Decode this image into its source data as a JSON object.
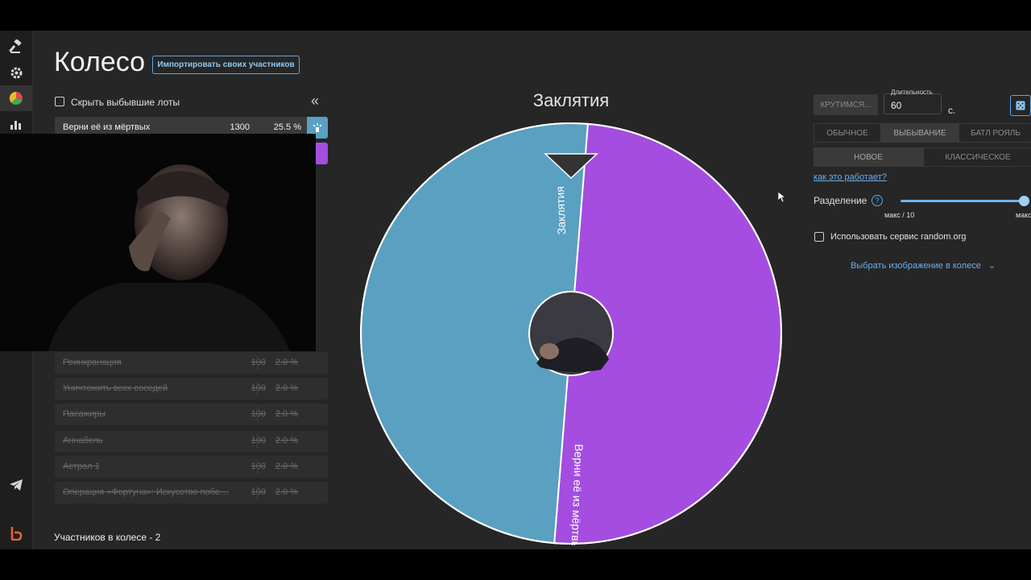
{
  "page": {
    "title": "Колесо",
    "import_button": "Импортировать своих участников",
    "hide_dropped_label": "Скрыть выбывшие лоты",
    "collapse_glyph": "«",
    "participants_count": "Участников в колесе - 2"
  },
  "sidebar": {
    "icons": [
      "gavel-icon",
      "gear-icon",
      "wheel-icon",
      "stats-icon",
      "telegram-icon",
      "brand-logo-icon"
    ]
  },
  "lots": {
    "active": {
      "name": "Верни её из мёртвых",
      "amount": "1300",
      "percent": "25.5 %",
      "accent": "#5aa0c0"
    },
    "second_accent": "#a44de0",
    "dropped": [
      {
        "name": "Реинкранация",
        "amount": "100",
        "percent": "2.0 %"
      },
      {
        "name": "Уничтожить всех соседей",
        "amount": "100",
        "percent": "2.0 %"
      },
      {
        "name": "Пасажиры",
        "amount": "100",
        "percent": "2.0 %"
      },
      {
        "name": "Аннабель",
        "amount": "100",
        "percent": "2.0 %"
      },
      {
        "name": "Астрал 1",
        "amount": "100",
        "percent": "2.0 %"
      },
      {
        "name": "Операция «Фортуна»: Искусство побе…",
        "amount": "100",
        "percent": "2.0 %"
      }
    ]
  },
  "wheel": {
    "title": "Заклятия",
    "segments": [
      {
        "label": "Заклятия",
        "share": 0.5,
        "color": "#a44de0"
      },
      {
        "label": "Верни её из мёртвых",
        "share": 0.5,
        "color": "#5aa0c0"
      }
    ]
  },
  "controls": {
    "spin_button": "КРУТИМСЯ...",
    "duration_label": "Длительность",
    "duration_value": "60",
    "duration_unit": "с.",
    "modes": [
      "ОБЫЧНОЕ",
      "ВЫБЫВАНИЕ",
      "БАТЛ РОЯЛЬ"
    ],
    "active_mode": "ВЫБЫВАНИЕ",
    "variants": [
      "НОВОЕ",
      "КЛАССИЧЕСКОЕ"
    ],
    "active_variant": "НОВОЕ",
    "how_it_works": "как это работает?",
    "split_label": "Разделение",
    "split_min": "макс / 10",
    "split_max": "макс",
    "split_level": 1.0,
    "random_org_label": "Использовать сервис random.org",
    "image_select": "Выбрать изображение в колесе"
  }
}
